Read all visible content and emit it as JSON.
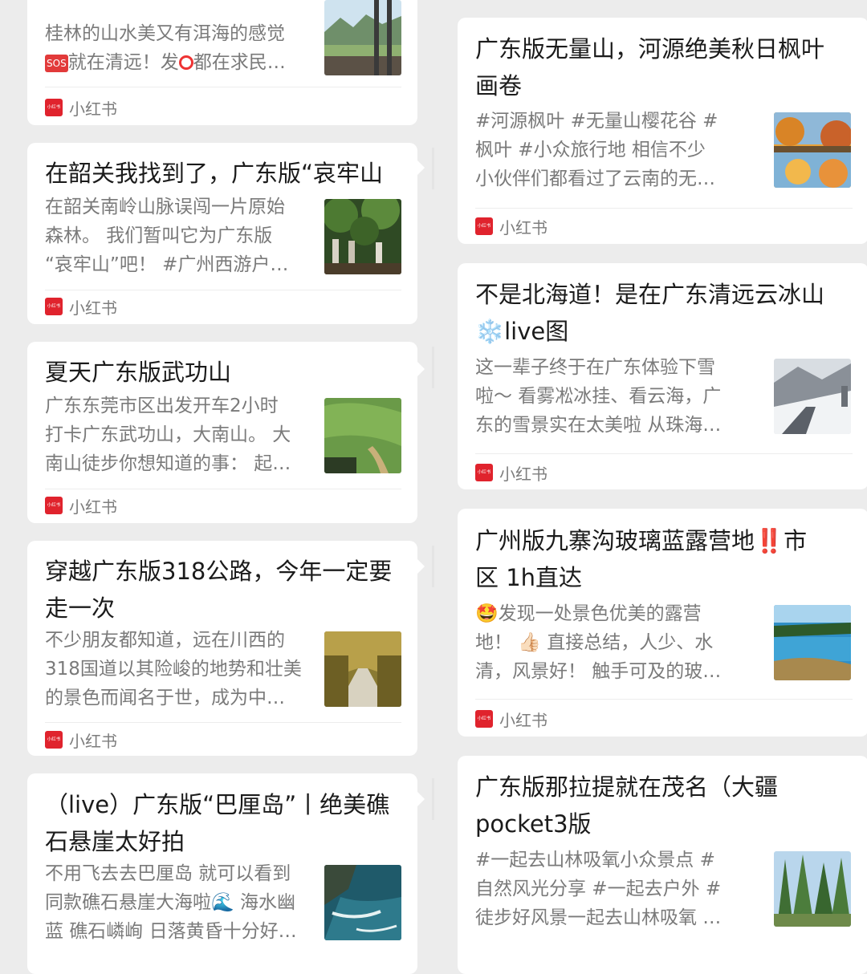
{
  "left": [
    {
      "title": "",
      "desc": [
        "桂林的山水美又有洱海的感觉",
        "就在清远！发",
        "都在求民…"
      ],
      "source": "小红书",
      "logo_text": "小红书"
    },
    {
      "title": "在韶关我找到了，广东版“哀牢山",
      "desc": [
        "在韶关南岭山脉误闯一片原始",
        "森林。 我们暂叫它为广东版",
        "“哀牢山”吧！ #广州西游户…"
      ],
      "source": "小红书",
      "logo_text": "小红书"
    },
    {
      "title": "夏天广东版武功山",
      "desc": [
        "广东东莞市区出发开车2小时",
        "打卡广东武功山，大南山。 大",
        "南山徒步你想知道的事： 起…"
      ],
      "source": "小红书",
      "logo_text": "小红书"
    },
    {
      "title_lines": [
        "穿越广东版318公路，今年一定要",
        "走一次"
      ],
      "desc": [
        "不少朋友都知道，远在川西的",
        "318国道以其险峻的地势和壮美",
        "的景色而闻名于世，成为中…"
      ],
      "source": "小红书",
      "logo_text": "小红书"
    },
    {
      "title_lines": [
        "（live）广东版“巴厘岛”丨绝美礁",
        "石悬崖太好拍"
      ],
      "desc": [
        "不用飞去去巴厘岛 就可以看到",
        "同款礁石悬崖大海啦🌊 海水幽",
        "蓝 礁石嶙峋 日落黄昏十分好…"
      ]
    }
  ],
  "right": [
    {
      "title_lines": [
        "广东版无量山，河源绝美秋日枫叶",
        "画卷"
      ],
      "desc": [
        "#河源枫叶 #无量山樱花谷 #",
        "枫叶 #小众旅行地 相信不少",
        "小伙伴们都看过了云南的无…"
      ],
      "source": "小红书",
      "logo_text": "小红书"
    },
    {
      "title_lines": [
        "不是北海道！是在广东清远云冰山",
        "❄️live图"
      ],
      "desc": [
        "这一辈子终于在广东体验下雪",
        "啦～ 看雾凇冰挂、看云海，广",
        "东的雪景实在太美啦 从珠海…"
      ],
      "source": "小红书",
      "logo_text": "小红书"
    },
    {
      "title_lines": [
        "广州版九寨沟玻璃蓝露营地‼️市",
        "区 1h直达"
      ],
      "desc": [
        "🤩发现一处景色优美的露营",
        "地！ 👍🏻 直接总结，人少、水",
        "清，风景好！ 触手可及的玻…"
      ],
      "source": "小红书",
      "logo_text": "小红书"
    },
    {
      "title_lines": [
        "广东版那拉提就在茂名（大疆",
        "pocket3版"
      ],
      "desc": [
        "#一起去山林吸氧小众景点 #",
        "自然风光分享 #一起去户外 #",
        "徒步好风景一起去山林吸氧 …"
      ]
    }
  ]
}
